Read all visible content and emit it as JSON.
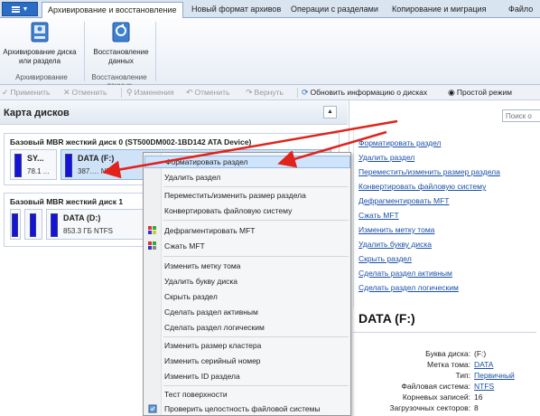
{
  "tabs": [
    {
      "label": "Архивирование и восстановление"
    },
    {
      "label": "Новый формат архивов"
    },
    {
      "label": "Операции с разделами"
    },
    {
      "label": "Копирование и миграция"
    },
    {
      "label": "Файло"
    }
  ],
  "ribbon": {
    "archive_label": "Архивирование диска или раздела",
    "restore_label": "Восстановление данных",
    "group1_label": "Архивирование",
    "group2_label": "Восстановление данных"
  },
  "toolbar": {
    "apply": "Применить",
    "cancel": "Отменить",
    "changes": "Изменения",
    "undo": "Отменить",
    "redo": "Вернуть",
    "refresh": "Обновить информацию о дисках",
    "simple_mode": "Простой режим"
  },
  "left_panel": {
    "title": "Карта дисков",
    "disk0": {
      "title": "Базовый MBR жесткий диск 0 (ST500DM002-1BD142 ATA Device)",
      "p1_name": "SY...",
      "p1_info": "78.1 ...",
      "p2_name": "DATA (F:)",
      "p2_info": "387.… NTFS"
    },
    "disk1": {
      "title": "Базовый MBR жесткий диск 1",
      "p3_name": "DATA (D:)",
      "p3_info": "853.3 ГБ NTFS"
    }
  },
  "context_menu": {
    "items": [
      "Форматировать раздел",
      "Удалить раздел",
      "Переместить/изменить размер раздела",
      "Конвертировать файловую систему",
      "Дефрагментировать MFT",
      "Сжать MFT",
      "Изменить метку тома",
      "Удалить букву диска",
      "Скрыть раздел",
      "Сделать раздел активным",
      "Сделать раздел логическим",
      "Изменить размер кластера",
      "Изменить серийный номер",
      "Изменить ID раздела",
      "Тест поверхности",
      "Проверить целостность файловой системы"
    ]
  },
  "right_panel": {
    "search_placeholder": "Поиск о",
    "operations": [
      "Форматировать раздел",
      "Удалить раздел",
      "Переместить/изменить размер раздела",
      "Конвертировать файловую систему",
      "Дефрагментировать MFT",
      "Сжать MFT",
      "Изменить метку тома",
      "Удалить букву диска",
      "Скрыть раздел",
      "Сделать раздел активным",
      "Сделать раздел логическим"
    ],
    "info_title": "DATA (F:)",
    "props": [
      {
        "k": "Буква диска:",
        "v": "(F:)"
      },
      {
        "k": "Метка тома:",
        "v": "DATA"
      },
      {
        "k": "Тип:",
        "v": "Первичный"
      },
      {
        "k": "Файловая система:",
        "v": "NTFS"
      },
      {
        "k": "Корневых записей:",
        "v": "16"
      },
      {
        "k": "Загрузочных секторов:",
        "v": "8"
      }
    ]
  },
  "colors": {
    "accent": "#2b6cc4",
    "partition_bar": "#1414d8",
    "arrow": "#e0241b",
    "link": "#1a4fa6"
  }
}
